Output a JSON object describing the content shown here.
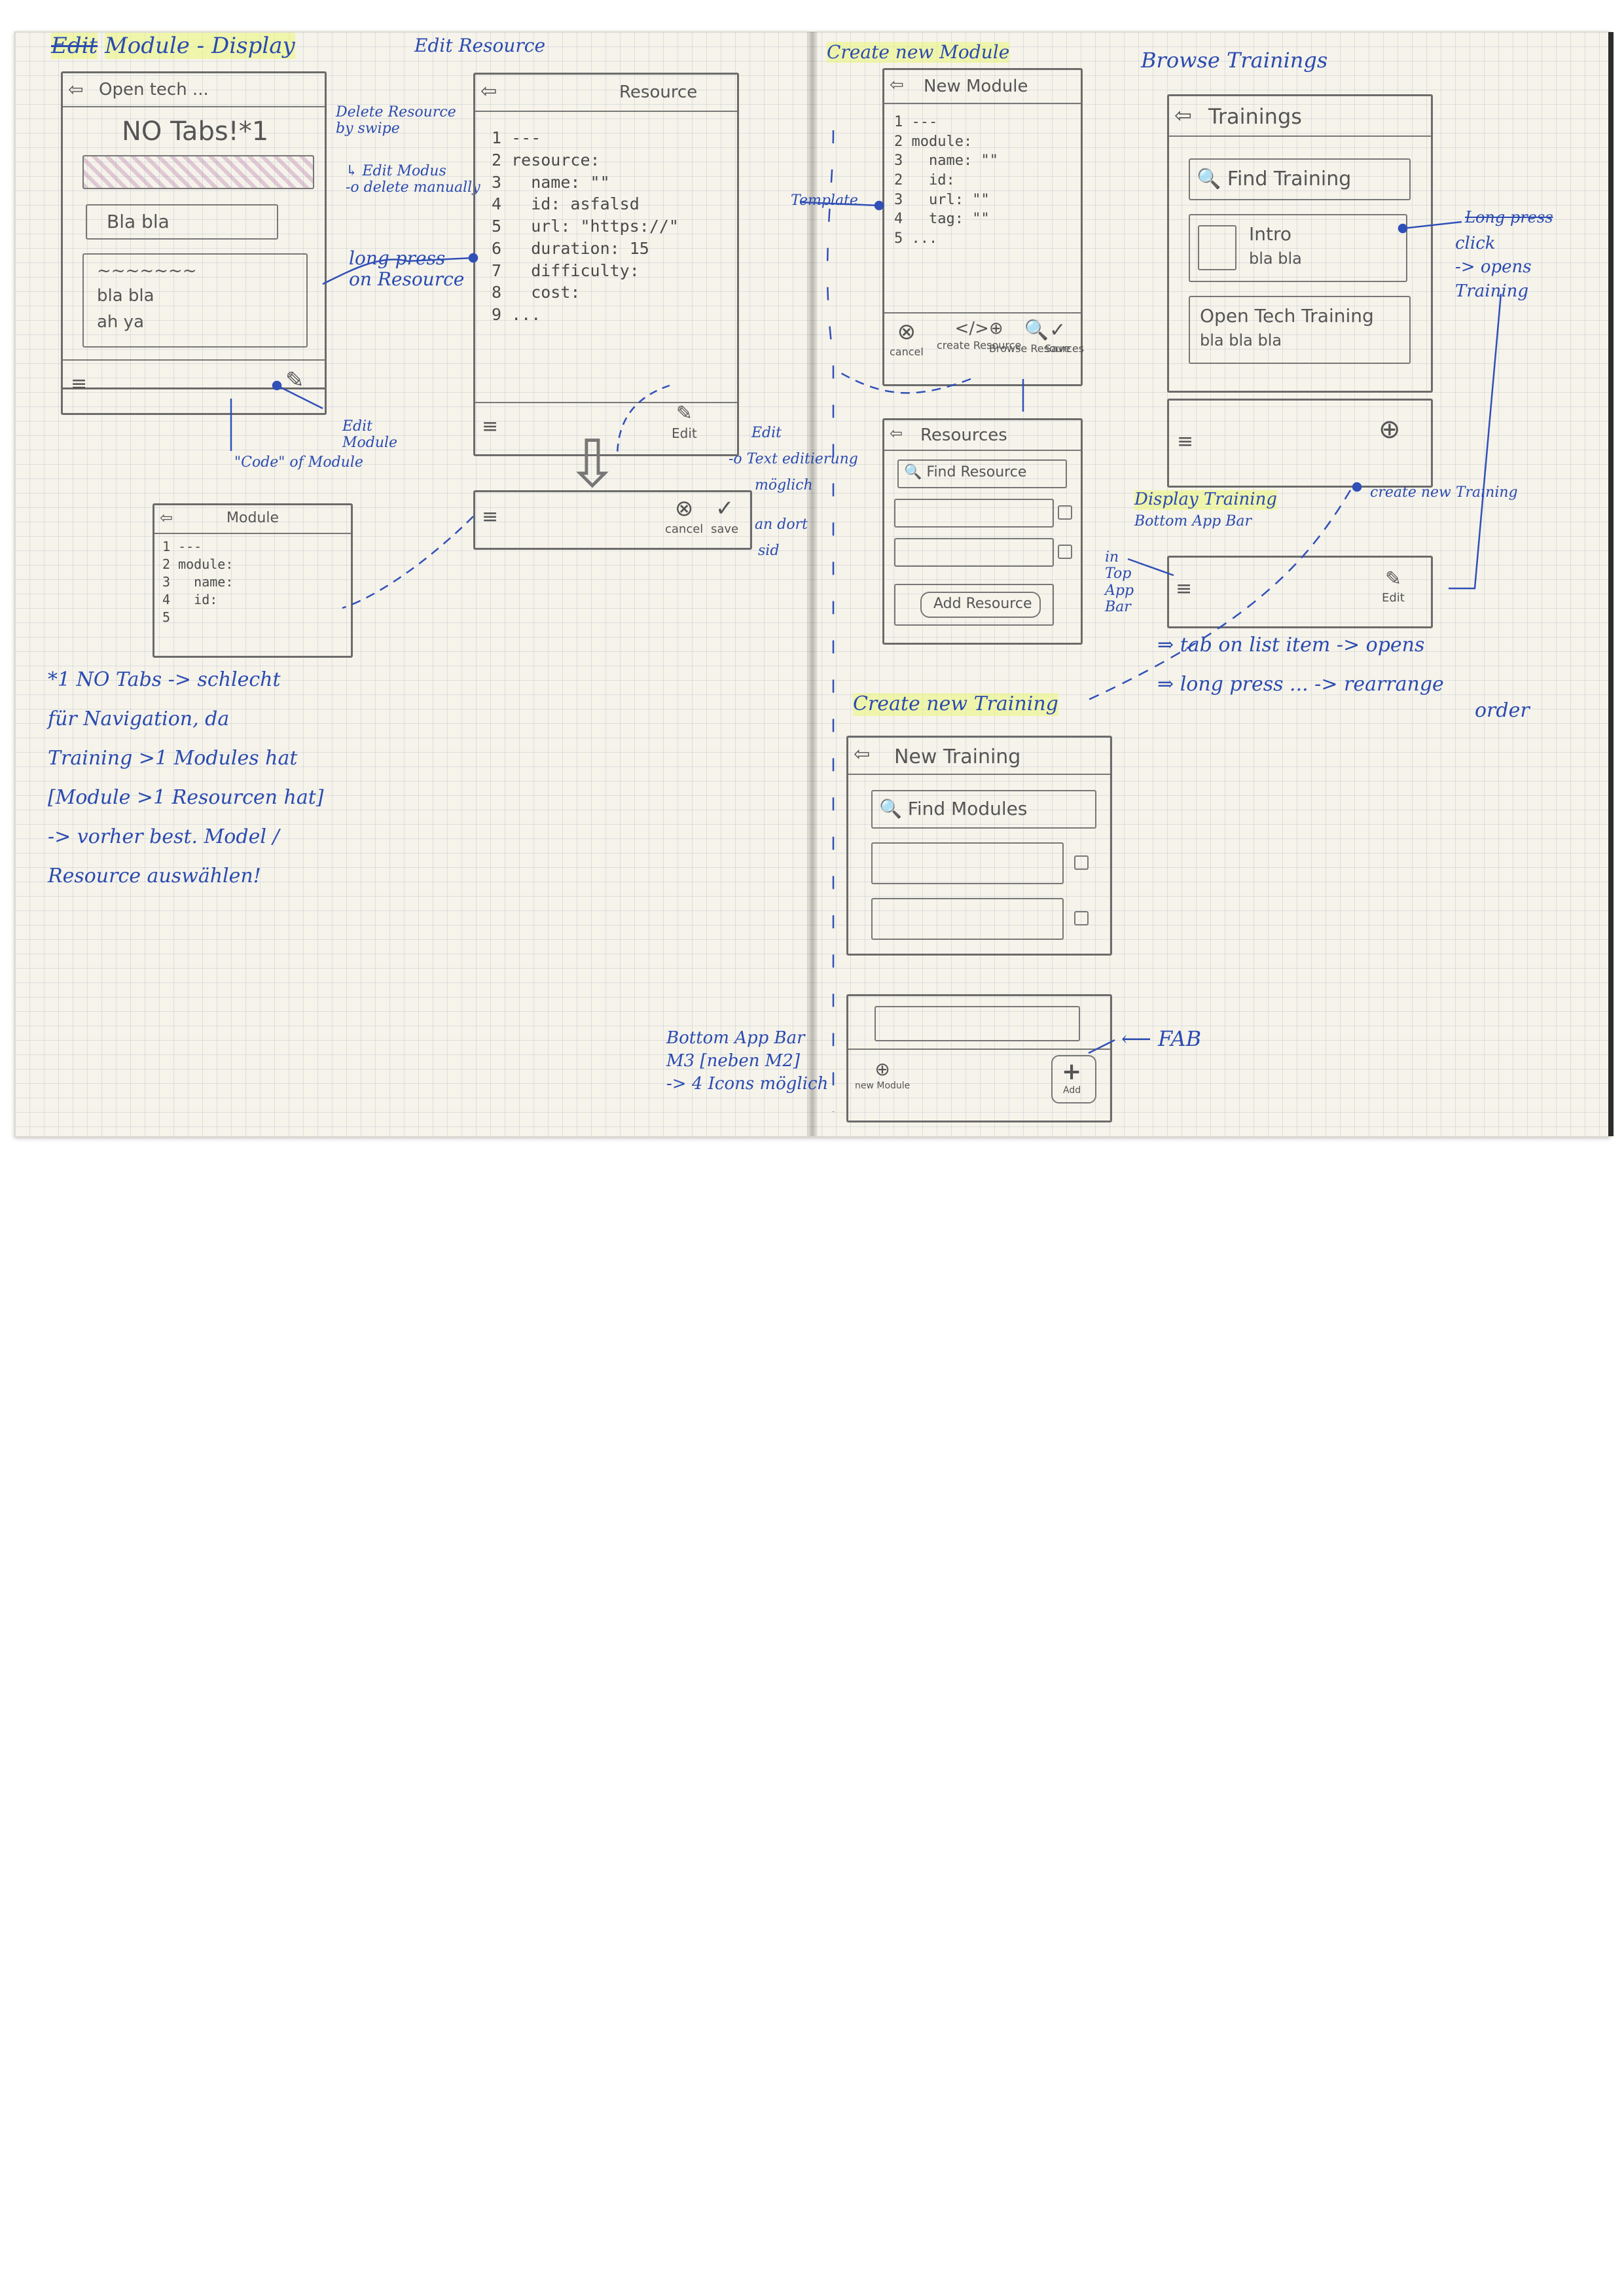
{
  "sketch_1": {
    "title": "Edit",
    "title_rest": "Module - Display",
    "phone_header": "Open tech ...",
    "no_tabs": "NO Tabs!*1",
    "text_field": "Bla bla",
    "card_line1": "bla bla",
    "card_line2": "ah ya",
    "note_delete": "Delete Resource",
    "note_swipe": "by swipe",
    "note_edit_mode": "Edit Modus",
    "note_delete_manually": "delete manually",
    "note_long_press": "long press",
    "note_on_resource": "on Resource",
    "note_edit_module": "Edit",
    "note_edit_module2": "Module",
    "note_code_module": "\"Code\" of Module",
    "small_header": "Module",
    "small_code": "1 ---\n2 module:\n3   name:\n4   id:\n5"
  },
  "sketch_2": {
    "title": "Edit Resource",
    "header": "Resource",
    "code": "1 ---\n2 resource:\n3   name: \"\"\n4   id: asfalsd\n5   url: \"https://\"\n6   duration: 15\n7   difficulty:\n8   cost:\n9 ...",
    "edit_label": "Edit",
    "cancel_label": "cancel",
    "save_label": "save",
    "note_edit": "Edit",
    "note_text_edit": "Text editierung",
    "note_moglich": "möglich",
    "note_an_dort": "an dort",
    "note_sid": "sid"
  },
  "sketch_3": {
    "title": "Create new Module",
    "header": "New Module",
    "code": "1 ---\n2 module:\n3   name: \"\"\n2   id:\n3   url: \"\"\n4   tag: \"\"\n5 ...",
    "template": "Template",
    "cancel": "cancel",
    "create_resource": "create Resource",
    "browse_resources": "Browse Resources",
    "save": "Save",
    "resources_header": "Resources",
    "find_resource": "Find Resource",
    "add_resource": "Add Resource"
  },
  "sketch_4": {
    "title": "Browse Trainings",
    "header": "Trainings",
    "find_training": "Find Training",
    "card1": "Intro",
    "card1_sub": "bla bla",
    "card2": "Open Tech Training",
    "card2_sub": "bla bla bla",
    "note_long_press": "Long press",
    "note_click": "click",
    "note_opens": "-> opens",
    "note_training": "Training",
    "create_new_training": "create new Training",
    "display_training": "Display Training",
    "bottom_app_bar": "Bottom App Bar",
    "in_top_app_bar": "in Top App Bar",
    "edit": "Edit",
    "tab_list": "tab on list item -> opens",
    "long_press_rearrange": "long press ... -> rearrange",
    "order": "order"
  },
  "sketch_5": {
    "title": "Create new Training",
    "header": "New Training",
    "find_modules": "Find Modules",
    "bottom_app_bar": "Bottom App Bar",
    "m3": "M3 [neben M2]",
    "icons": "-> 4 Icons möglich",
    "fab": "FAB",
    "add": "Add",
    "new_module": "new Module"
  },
  "footnote": {
    "line1": "*1 NO Tabs -> schlecht",
    "line2": "für Navigation, da",
    "line3": "Training >1 Modules hat",
    "line4": "[Module >1 Resourcen hat]",
    "line5": "-> vorher best. Model /",
    "line6": "Resource auswählen!"
  }
}
